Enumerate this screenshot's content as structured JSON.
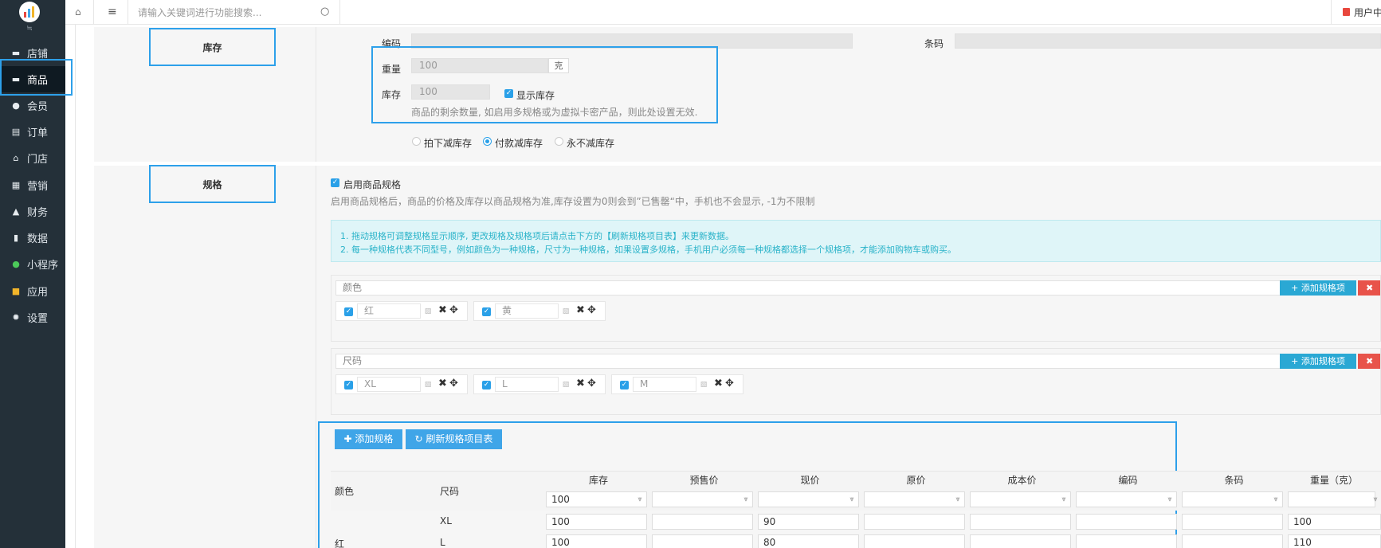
{
  "sidebar": {
    "items": [
      {
        "label": "店铺",
        "icon": "store-icon"
      },
      {
        "label": "商品",
        "icon": "goods-icon"
      },
      {
        "label": "会员",
        "icon": "user-icon"
      },
      {
        "label": "订单",
        "icon": "order-icon"
      },
      {
        "label": "门店",
        "icon": "shop-icon"
      },
      {
        "label": "营销",
        "icon": "marketing-icon"
      },
      {
        "label": "财务",
        "icon": "finance-icon"
      },
      {
        "label": "数据",
        "icon": "chart-icon"
      },
      {
        "label": "小程序",
        "icon": "miniprogram-icon"
      },
      {
        "label": "应用",
        "icon": "apps-icon"
      },
      {
        "label": "设置",
        "icon": "gear-icon"
      }
    ],
    "active": "商品"
  },
  "topbar": {
    "search_placeholder": "请输入关键词进行功能搜索...",
    "user_label": "用户中"
  },
  "stock_section": {
    "title": "库存",
    "code_label": "编码",
    "barcode_label": "条码",
    "weight_label": "重量",
    "weight_value": "100",
    "weight_unit": "克",
    "stock_label": "库存",
    "stock_value": "100",
    "show_stock_label": "显示库存",
    "stock_hint": "商品的剩余数量, 如启用多规格或为虚拟卡密产品，则此处设置无效.",
    "deduct_options": [
      "拍下减库存",
      "付款减库存",
      "永不减库存"
    ],
    "deduct_selected": "付款减库存"
  },
  "spec_section": {
    "title": "规格",
    "enable_label": "启用商品规格",
    "enable_hint": "启用商品规格后，商品的价格及库存以商品规格为准,库存设置为0则会到”已售罄“中，手机也不会显示, -1为不限制",
    "tip1": "1. 拖动规格可调整规格显示顺序, 更改规格及规格项后请点击下方的【刷新规格项目表】来更新数据。",
    "tip2": "2. 每一种规格代表不同型号，例如颜色为一种规格，尺寸为一种规格，如果设置多规格，手机用户必须每一种规格都选择一个规格项，才能添加购物车或购买。",
    "groups": [
      {
        "name": "颜色",
        "items": [
          "红",
          "黄"
        ]
      },
      {
        "name": "尺码",
        "items": [
          "XL",
          "L",
          "M"
        ]
      }
    ],
    "add_item_label": "+ 添加规格项",
    "add_spec_label": "添加规格",
    "refresh_label": "刷新规格项目表"
  },
  "spec_table": {
    "headers": [
      "库存",
      "预售价",
      "现价",
      "原价",
      "成本价",
      "编码",
      "条码",
      "重量（克）"
    ],
    "col_color": "颜色",
    "col_size": "尺码",
    "batch_stock": "100",
    "rows": [
      {
        "color": "",
        "size": "XL",
        "stock": "100",
        "price": "90",
        "weight": "100"
      },
      {
        "color": "红",
        "size": "L",
        "stock": "100",
        "price": "80",
        "weight": "110"
      }
    ]
  }
}
